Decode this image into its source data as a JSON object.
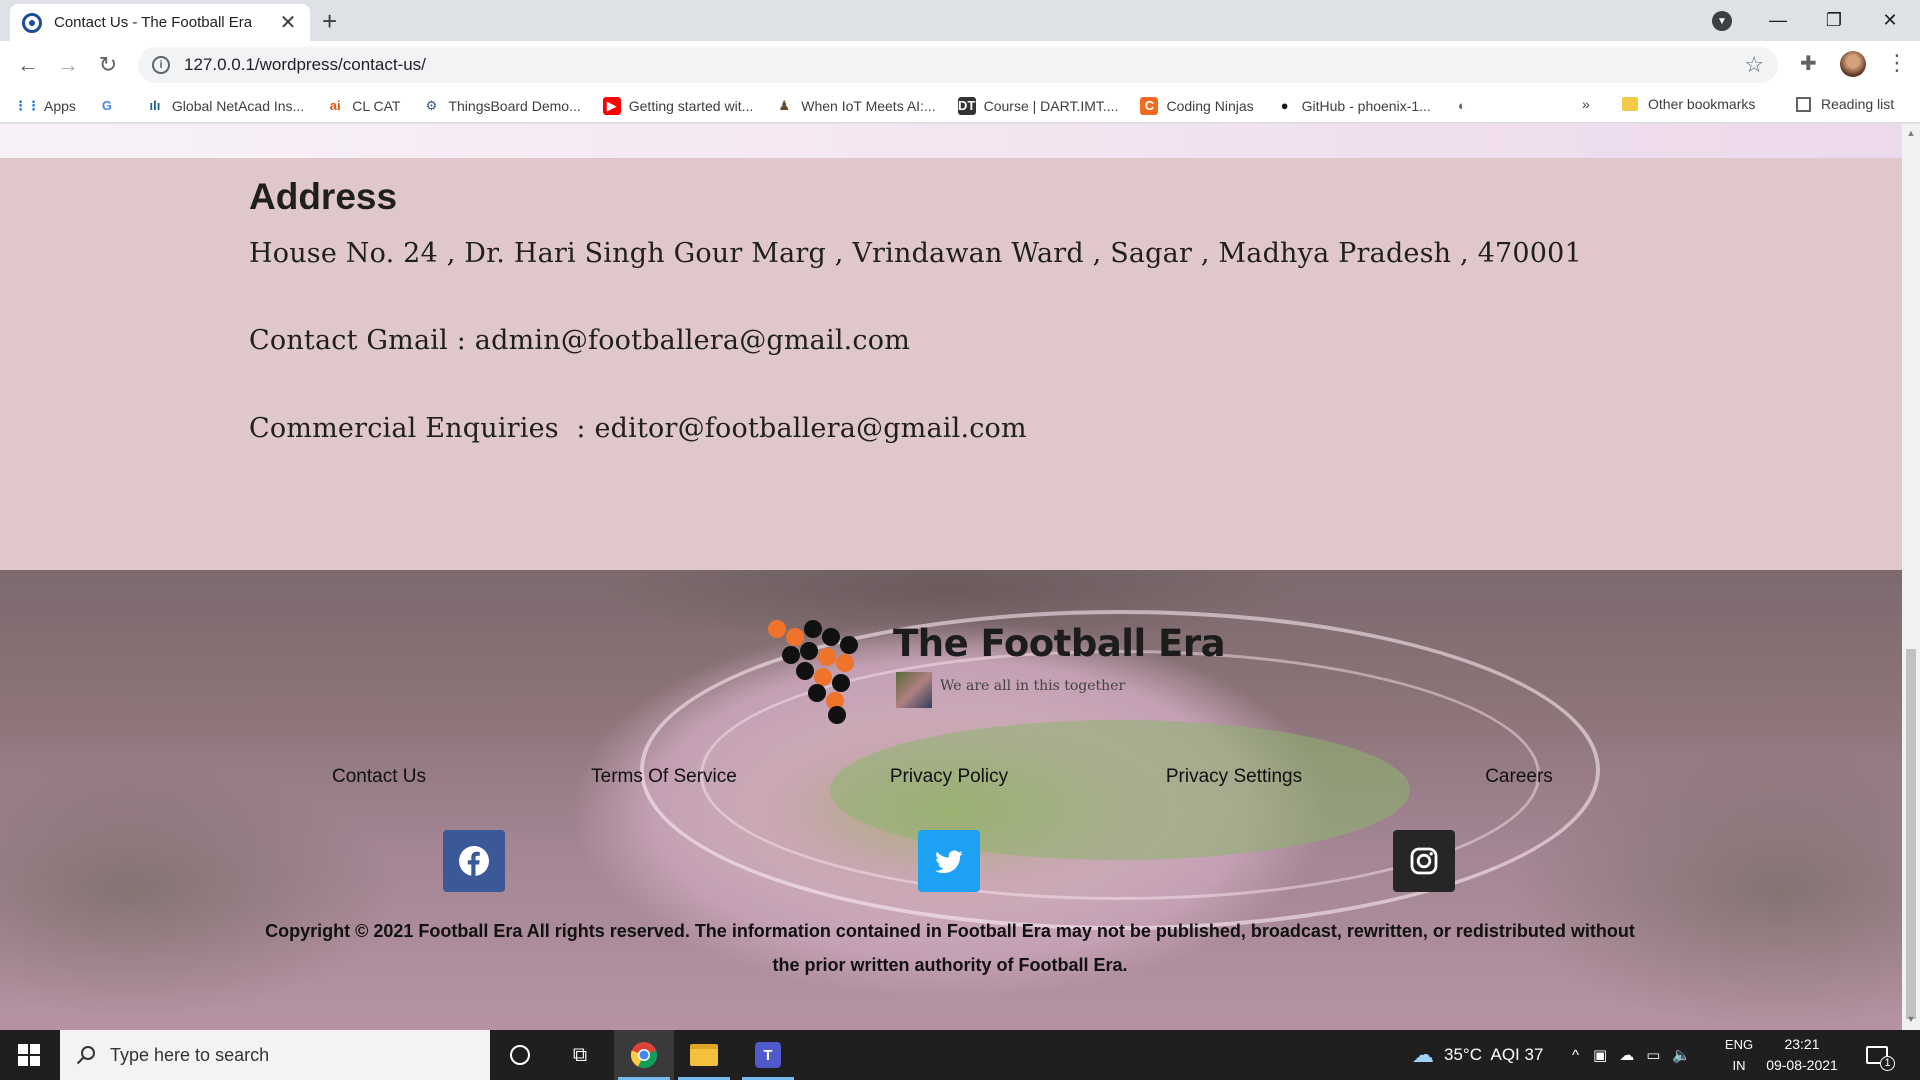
{
  "browser": {
    "tab_title": "Contact Us - The Football Era",
    "url": "127.0.0.1/wordpress/contact-us/",
    "bookmarks": [
      {
        "label": "Apps",
        "icon": "apps-grid-icon"
      },
      {
        "label": "",
        "icon": "google-icon"
      },
      {
        "label": "Global NetAcad Ins...",
        "icon": "cisco-icon"
      },
      {
        "label": "CL CAT",
        "icon": "ai-icon"
      },
      {
        "label": "ThingsBoard Demo...",
        "icon": "thingsboard-icon"
      },
      {
        "label": "Getting started wit...",
        "icon": "youtube-icon"
      },
      {
        "label": "When IoT Meets AI:...",
        "icon": "person-icon"
      },
      {
        "label": "Course | DART.IMT....",
        "icon": "dart-icon"
      },
      {
        "label": "Coding Ninjas",
        "icon": "coding-ninjas-icon"
      },
      {
        "label": "GitHub - phoenix-1...",
        "icon": "github-icon"
      },
      {
        "label": "",
        "icon": "globe-icon"
      }
    ],
    "more_bookmarks": "»",
    "other_bookmarks": "Other bookmarks",
    "reading_list": "Reading list"
  },
  "contact": {
    "heading": "Address",
    "address": "House No. 24 , Dr. Hari Singh Gour Marg , Vrindawan Ward , Sagar , Madhya Pradesh , 470001",
    "gmail": "Contact Gmail : admin@footballera@gmail.com",
    "enquiries": "Commercial Enquiries  : editor@footballera@gmail.com"
  },
  "footer": {
    "logo_title": "The Football Era",
    "logo_tagline": "We are all in this together",
    "links": [
      "Contact Us",
      "Terms Of Service",
      "Privacy Policy",
      "Privacy Settings",
      "Careers"
    ],
    "social": [
      {
        "name": "facebook",
        "color": "#3b5998"
      },
      {
        "name": "twitter",
        "color": "#1da1f2"
      },
      {
        "name": "instagram",
        "color": "#262626"
      }
    ],
    "copyright": "Copyright © 2021 Football Era All rights reserved. The information contained in Football Era may not be published, broadcast, rewritten, or redistributed without the prior written authority of Football Era."
  },
  "taskbar": {
    "search_placeholder": "Type here to search",
    "weather": "35°C  AQI 37",
    "lang_line1": "ENG",
    "lang_line2": "IN",
    "time": "23:21",
    "date": "09-08-2021",
    "notification_count": "1"
  }
}
